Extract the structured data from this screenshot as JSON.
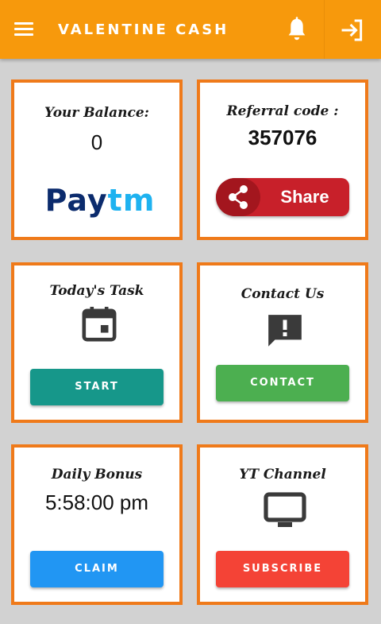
{
  "app": {
    "title": "VALENTINE CASH"
  },
  "colors": {
    "appbar": "#f7990c",
    "card_border": "#ef7a1a",
    "start": "#16978a",
    "contact": "#4caf50",
    "claim": "#2196f3",
    "subscribe": "#f44336",
    "share": "#c8202a"
  },
  "icons": {
    "menu": "menu-icon",
    "bell": "bell-icon",
    "logout": "logout-icon",
    "share": "share-icon",
    "task": "calendar-icon",
    "contact": "feedback-icon",
    "yt": "tv-icon"
  },
  "balance": {
    "label": "Your Balance:",
    "value": "0",
    "logo_text": {
      "pay": "Pay",
      "tm": "tm"
    }
  },
  "referral": {
    "label": "Referral code :",
    "value": "357076",
    "share_label": "Share"
  },
  "task": {
    "label": "Today's Task",
    "button": "START"
  },
  "contact": {
    "label": "Contact Us",
    "button": "CONTACT"
  },
  "bonus": {
    "label": "Daily Bonus",
    "value": "5:58:00 pm",
    "button": "CLAIM"
  },
  "yt": {
    "label": "YT Channel",
    "button": "SUBSCRIBE"
  }
}
